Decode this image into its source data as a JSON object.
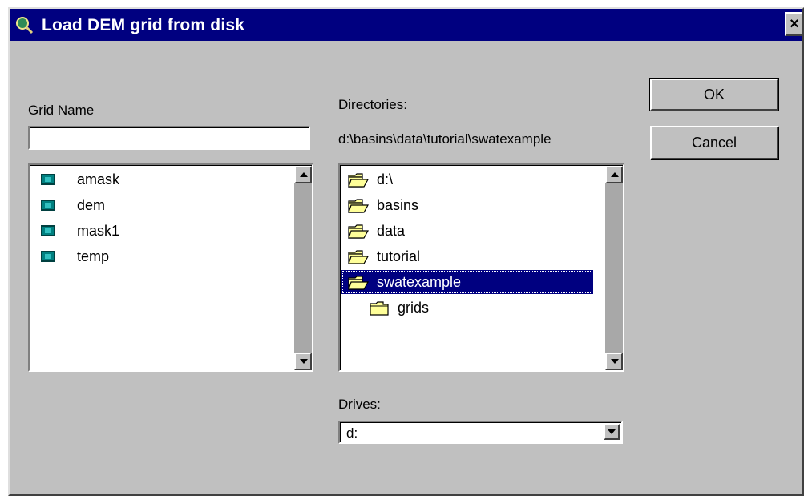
{
  "window": {
    "title": "Load DEM grid from disk",
    "close_glyph": "×",
    "icon": "globe-search-icon"
  },
  "grid_name": {
    "label": "Grid Name",
    "value": "",
    "items": [
      "amask",
      "dem",
      "mask1",
      "temp"
    ],
    "item_icon": "grid-layer-icon"
  },
  "directories": {
    "label": "Directories:",
    "current_path": "d:\\basins\\data\\tutorial\\swatexample",
    "items": [
      "d:\\",
      "basins",
      "data",
      "tutorial",
      "swatexample",
      "grids"
    ],
    "selected": "swatexample",
    "folder_icon": "folder-icon"
  },
  "drives": {
    "label": "Drives:",
    "selected": "d:"
  },
  "buttons": {
    "ok": "OK",
    "cancel": "Cancel"
  },
  "colors": {
    "titlebar": "#000080",
    "dialog": "#c0c0c0",
    "selection": "#000080",
    "grid_icon": "#008080",
    "folder": "#ffff99"
  }
}
